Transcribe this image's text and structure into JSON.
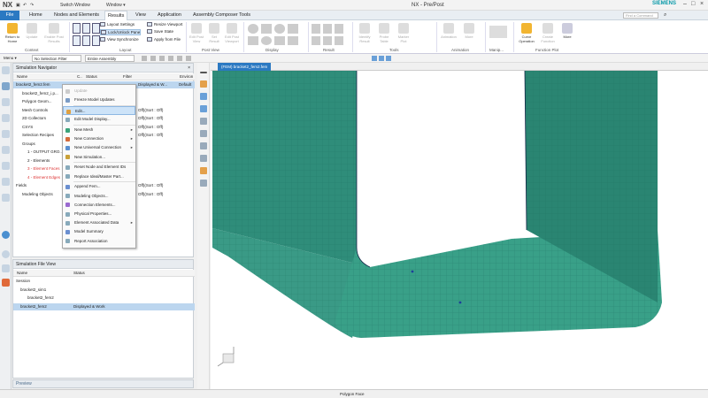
{
  "titlebar": {
    "logo": "NX",
    "switch_window": "Switch Window",
    "window_menu": "Window ▾",
    "title": "NX - Pre/Post",
    "brand": "SIEMENS"
  },
  "tabs": [
    "File",
    "Home",
    "Nodes and Elements",
    "Results",
    "View",
    "Application",
    "Assembly Composer Tools"
  ],
  "active_tab": "Results",
  "search": {
    "placeholder": "Find a Command"
  },
  "ribbon": {
    "context": {
      "return_label": "Return to Home",
      "update_label": "Update",
      "model_label": "Enable Post Results",
      "group": "Context"
    },
    "layout": {
      "items": [
        "Layout Settings",
        "Lock/Unlock Pane",
        "View Synchronize"
      ],
      "items2": [
        "Resize Viewport",
        "Save State",
        "Apply from File"
      ],
      "group": "Layout"
    },
    "post_view": {
      "group": "Post View",
      "btns": [
        "Edit Post View",
        "Set Result",
        "Edit Post Viewport"
      ]
    },
    "display": {
      "group": "Display"
    },
    "result": {
      "group": "Result"
    },
    "tools": {
      "group": "Tools",
      "btns": [
        "Identify Result",
        "Probe Table",
        "Marker Plot"
      ]
    },
    "animation": {
      "group": "Animation",
      "btns": [
        "Animation",
        "More"
      ]
    },
    "manip": {
      "group": "Manip..."
    },
    "function_plot": {
      "group": "Function Plot",
      "btns": [
        "Curve Operation",
        "Create Function",
        "More"
      ]
    }
  },
  "filterbar": {
    "menu": "Menu ▾",
    "selection_filter": "No Selection Filter",
    "assembly": "Entire Assembly"
  },
  "sim_nav": {
    "title": "Simulation Navigator",
    "columns": [
      "Name",
      "C..",
      "Status",
      "Filter",
      "Environ"
    ],
    "rows": [
      {
        "name": "bracket2_fem2.fem",
        "status": "Displayed & W...",
        "env": "Default",
        "selected": true
      },
      {
        "name": "bracket2_fem2_i.p...",
        "status": ""
      },
      {
        "name": "Polygon Geom...",
        "status": ""
      },
      {
        "name": "Mesh Controls",
        "status": "Off)(Sort : Off)"
      },
      {
        "name": "2D Collectors",
        "status": "Off)(Sort : Off)"
      },
      {
        "name": "CSYS",
        "status": "Off)(Sort : Off)"
      },
      {
        "name": "Selection Recipes",
        "status": "Off)(Sort : Off)"
      },
      {
        "name": "Groups",
        "status": ""
      },
      {
        "name": "1 - OUTPUT GRO...",
        "status": ""
      },
      {
        "name": "2 - Elements",
        "status": ""
      },
      {
        "name": "3 - Element Faces",
        "status": "",
        "red": true
      },
      {
        "name": "4 - Element Edges",
        "status": "",
        "red": true
      },
      {
        "name": "Fields",
        "status": "Off)(Sort : Off)"
      },
      {
        "name": "Modeling Objects",
        "status": "Off)(Sort : Off)"
      }
    ]
  },
  "context_menu": {
    "items": [
      {
        "label": "Update",
        "disabled": true
      },
      {
        "label": "Freeze Model Updates"
      },
      {
        "label": "Edit...",
        "hover": true
      },
      {
        "label": "Edit Model Display..."
      },
      {
        "label": "New Mesh",
        "sub": true
      },
      {
        "label": "New Connection",
        "sub": true
      },
      {
        "label": "New Universal Connection",
        "sub": true
      },
      {
        "label": "New Simulation..."
      },
      {
        "label": "Reset Node and Element IDs"
      },
      {
        "label": "Replace Ideal/Master Part..."
      },
      {
        "label": "Append Fem..."
      },
      {
        "label": "Modeling Objects..."
      },
      {
        "label": "Connection Elements..."
      },
      {
        "label": "Physical Properties..."
      },
      {
        "label": "Element Associated Data",
        "sub": true
      },
      {
        "label": "Model Summary"
      },
      {
        "label": "Report Association"
      }
    ]
  },
  "file_view": {
    "title": "Simulation File View",
    "columns": [
      "Name",
      "Status"
    ],
    "rows": [
      {
        "name": "Session",
        "status": ""
      },
      {
        "name": "bracket2_sim1",
        "status": ""
      },
      {
        "name": "bracket2_fem2",
        "status": ""
      },
      {
        "name": "bracket2_fem2",
        "status": "Displayed & Work",
        "selected": true
      }
    ]
  },
  "preview": {
    "label": "Preview"
  },
  "graphics_tab": {
    "label": "(FEM) bracket2_fem2.fem"
  },
  "status_bar": {
    "text": "Polygon Face"
  },
  "colors": {
    "mesh": "#2f8d7a",
    "mesh_dark": "#1f6e60",
    "accent": "#2b79c2"
  }
}
